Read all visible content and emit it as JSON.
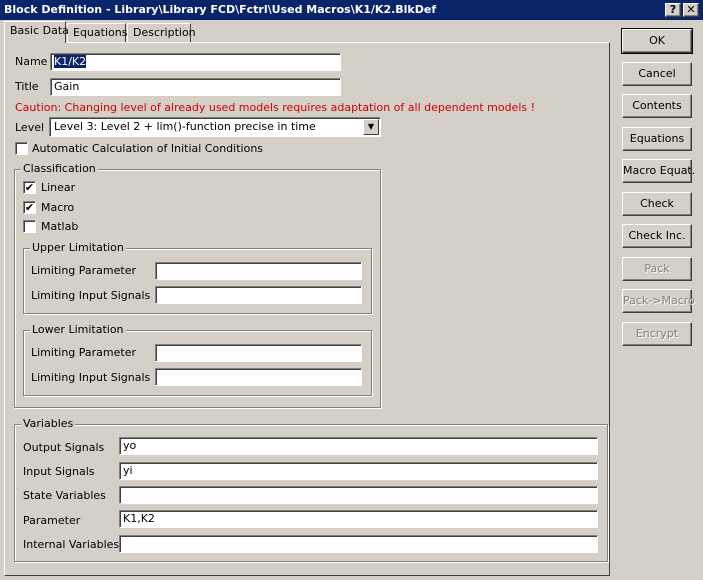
{
  "window": {
    "title": "Block Definition - Library\\Library FCD\\Fctrl\\Used Macros\\K1/K2.BlkDef",
    "help_label": "?",
    "close_label": "✕"
  },
  "tabs": [
    {
      "label": "Basic Data",
      "active": true
    },
    {
      "label": "Equations",
      "active": false
    },
    {
      "label": "Description",
      "active": false
    }
  ],
  "basic": {
    "name_label": "Name",
    "name_value": "K1/K2",
    "title_label": "Title",
    "title_value": "Gain",
    "caution": "Caution: Changing level of already used models requires adaptation of all dependent models !",
    "caution_color": "#cc0000",
    "level_label": "Level",
    "level_value": "Level 3: Level 2 + lim()-function precise in time",
    "auto_calc_label": "Automatic Calculation of Initial Conditions",
    "auto_calc_checked": false
  },
  "classification": {
    "legend": "Classification",
    "linear_label": "Linear",
    "linear_checked": true,
    "macro_label": "Macro",
    "macro_checked": true,
    "matlab_label": "Matlab",
    "matlab_checked": false,
    "check_mark": "✔",
    "upper": {
      "legend": "Upper Limitation",
      "param_label": "Limiting Parameter",
      "param_value": "",
      "inputs_label": "Limiting Input Signals",
      "inputs_value": ""
    },
    "lower": {
      "legend": "Lower Limitation",
      "param_label": "Limiting Parameter",
      "param_value": "",
      "inputs_label": "Limiting Input Signals",
      "inputs_value": ""
    }
  },
  "variables": {
    "legend": "Variables",
    "output_label": "Output Signals",
    "output_value": "yo",
    "input_label": "Input Signals",
    "input_value": "yi",
    "state_label": "State Variables",
    "state_value": "",
    "param_label": "Parameter",
    "param_value": "K1,K2",
    "internal_label": "Internal Variables",
    "internal_value": ""
  },
  "buttons": {
    "ok": "OK",
    "cancel": "Cancel",
    "contents": "Contents",
    "equations": "Equations",
    "macro_equat": "Macro Equat.",
    "check": "Check",
    "check_inc": "Check Inc.",
    "pack": "Pack",
    "pack_macro": "Pack->Macro",
    "encrypt": "Encrypt"
  }
}
